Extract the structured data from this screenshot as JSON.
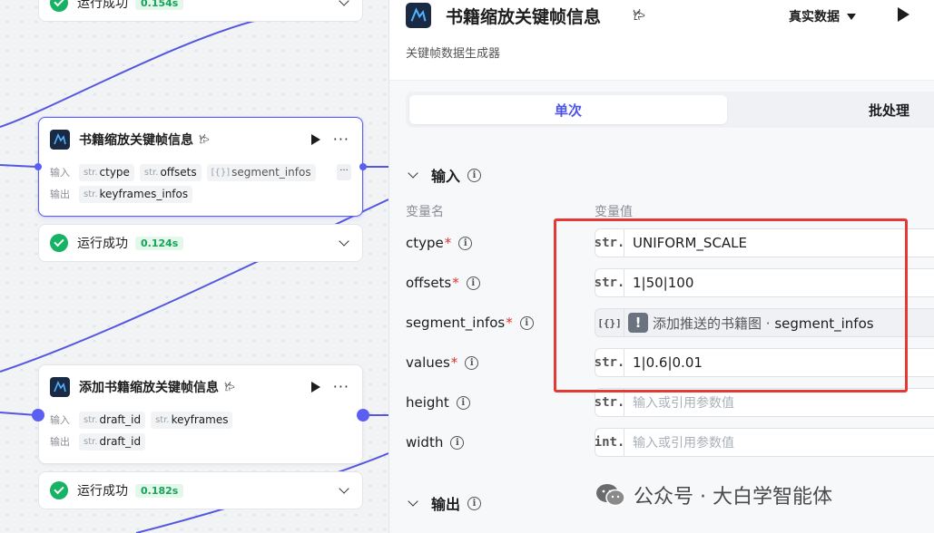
{
  "canvas": {
    "node_top_status": {
      "text": "运行成功",
      "time": "0.154s"
    },
    "node1": {
      "title": "书籍缩放关键帧信息",
      "mini_icon": "𐂂",
      "input_label": "输入",
      "output_label": "输出",
      "inputs": [
        {
          "type": "str.",
          "name": "ctype"
        },
        {
          "type": "str.",
          "name": "offsets"
        },
        {
          "type": "[{}]",
          "name": "segment_infos"
        }
      ],
      "outputs": [
        {
          "type": "str.",
          "name": "keyframes_infos"
        }
      ],
      "more_label": "···",
      "status": {
        "text": "运行成功",
        "time": "0.124s"
      }
    },
    "node2": {
      "title": "添加书籍缩放关键帧信息",
      "mini_icon": "𐂂",
      "input_label": "输入",
      "output_label": "输出",
      "inputs": [
        {
          "type": "str.",
          "name": "draft_id"
        },
        {
          "type": "str.",
          "name": "keyframes"
        }
      ],
      "outputs": [
        {
          "type": "str.",
          "name": "draft_id"
        }
      ],
      "status": {
        "text": "运行成功",
        "time": "0.182s"
      }
    }
  },
  "panel": {
    "title": "书籍缩放关键帧信息",
    "mini_icon": "𐂂",
    "data_mode": "真实数据",
    "description": "关键帧数据生成器",
    "tabs": {
      "single": "单次",
      "batch": "批处理"
    },
    "input_section": "输入",
    "output_section": "输出",
    "col_name": "变量名",
    "col_value": "变量值",
    "params": [
      {
        "name": "ctype",
        "required": "*",
        "type": "str.",
        "value": "UNIFORM_SCALE"
      },
      {
        "name": "offsets",
        "required": "*",
        "type": "str.",
        "value": "1|50|100"
      },
      {
        "name": "segment_infos",
        "required": "*",
        "type": "[{}]",
        "ref_node": "添加推送的书籍图 ·",
        "ref_var": "segment_infos"
      },
      {
        "name": "values",
        "required": "*",
        "type": "str.",
        "value": "1|0.6|0.01"
      },
      {
        "name": "height",
        "type": "str.",
        "placeholder": "输入或引用参数值"
      },
      {
        "name": "width",
        "type": "int.",
        "placeholder": "输入或引用参数值"
      }
    ]
  },
  "watermark": "公众号 · 大白学智能体",
  "colors": {
    "accent": "#5b5ff1",
    "success": "#16b364",
    "highlight": "#e53935"
  }
}
